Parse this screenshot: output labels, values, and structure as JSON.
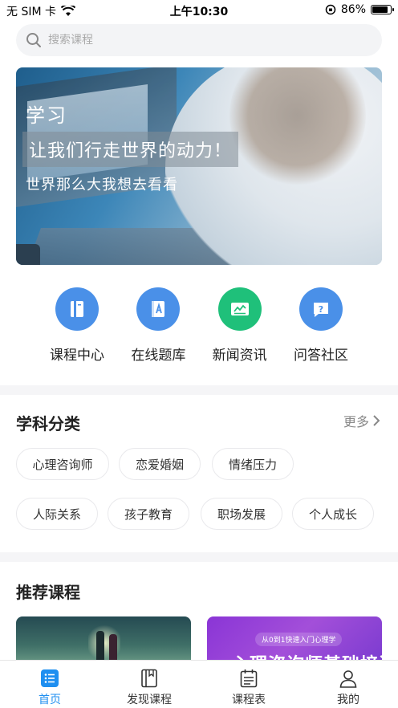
{
  "status_bar": {
    "carrier": "无 SIM 卡",
    "time": "上午10:30",
    "battery": "86%",
    "battery_level": 0.86
  },
  "search": {
    "placeholder": "搜索课程"
  },
  "banner": {
    "title": "学习",
    "slogan": "让我们行走世界的动力！",
    "subtitle": "世界那么大我想去看看"
  },
  "quick_nav": [
    {
      "label": "课程中心",
      "icon": "book-icon",
      "color": "#4a90e8"
    },
    {
      "label": "在线题库",
      "icon": "question-bank-icon",
      "color": "#4a90e8"
    },
    {
      "label": "新闻资讯",
      "icon": "news-icon",
      "color": "#1fc07a"
    },
    {
      "label": "问答社区",
      "icon": "qa-icon",
      "color": "#4a90e8"
    }
  ],
  "categories": {
    "title": "学科分类",
    "more": "更多",
    "tags": [
      "心理咨询师",
      "恋爱婚姻",
      "情绪压力",
      "人际关系",
      "孩子教育",
      "职场发展",
      "个人成长"
    ]
  },
  "recommended": {
    "title": "推荐课程",
    "cards": [
      {
        "kind": "illustration"
      },
      {
        "pill": "从0到1快速入门心理学",
        "headline": "心理咨询师基础培训"
      }
    ]
  },
  "tab_bar": {
    "active": 0,
    "tabs": [
      {
        "label": "首页",
        "icon": "home-list-icon"
      },
      {
        "label": "发现课程",
        "icon": "discover-book-icon"
      },
      {
        "label": "课程表",
        "icon": "schedule-icon"
      },
      {
        "label": "我的",
        "icon": "profile-icon"
      }
    ]
  }
}
